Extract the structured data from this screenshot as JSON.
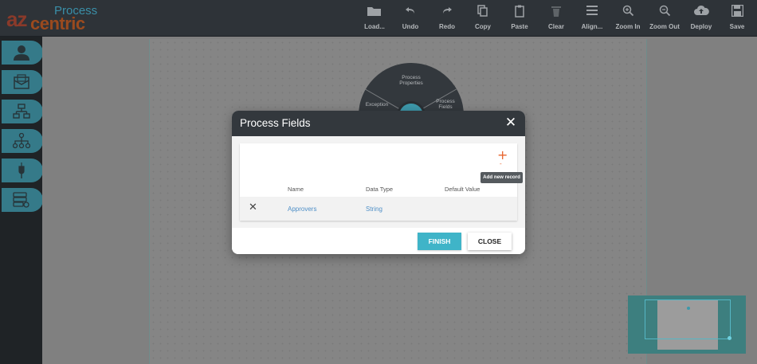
{
  "logo": {
    "az": "az",
    "process": "Process",
    "centric": "centric"
  },
  "toolbar": {
    "items": [
      {
        "label": "Load...",
        "icon": "folder-icon"
      },
      {
        "label": "Undo",
        "icon": "undo-icon"
      },
      {
        "label": "Redo",
        "icon": "redo-icon"
      },
      {
        "label": "Copy",
        "icon": "copy-icon"
      },
      {
        "label": "Paste",
        "icon": "paste-icon"
      },
      {
        "label": "Clear",
        "icon": "trash-icon"
      },
      {
        "label": "Align...",
        "icon": "align-icon"
      },
      {
        "label": "Zoom In",
        "icon": "zoom-in-icon"
      },
      {
        "label": "Zoom Out",
        "icon": "zoom-out-icon"
      },
      {
        "label": "Deploy",
        "icon": "cloud-upload-icon"
      },
      {
        "label": "Save",
        "icon": "save-icon"
      }
    ]
  },
  "sidebar": {
    "items": [
      {
        "icon": "user-icon"
      },
      {
        "icon": "mail-icon"
      },
      {
        "icon": "hierarchy-icon"
      },
      {
        "icon": "org-chart-icon"
      },
      {
        "icon": "plug-icon"
      },
      {
        "icon": "database-settings-icon"
      }
    ]
  },
  "wheel": {
    "process_properties": "Process Properties",
    "process_fields": "Process Fields",
    "exception": "Exception"
  },
  "modal": {
    "title": "Process Fields",
    "add_tooltip": "Add new record",
    "columns": {
      "name": "Name",
      "data_type": "Data Type",
      "default_value": "Default Value"
    },
    "rows": [
      {
        "name": "Approvers",
        "data_type": "String",
        "default_value": ""
      }
    ],
    "finish_label": "FINISH",
    "close_label": "CLOSE",
    "minus_mark": "-"
  },
  "colors": {
    "accent": "#3fb4c8",
    "toolbar_bg": "#2e3338",
    "add_icon": "#e8642e",
    "link": "#4e8fc7"
  }
}
